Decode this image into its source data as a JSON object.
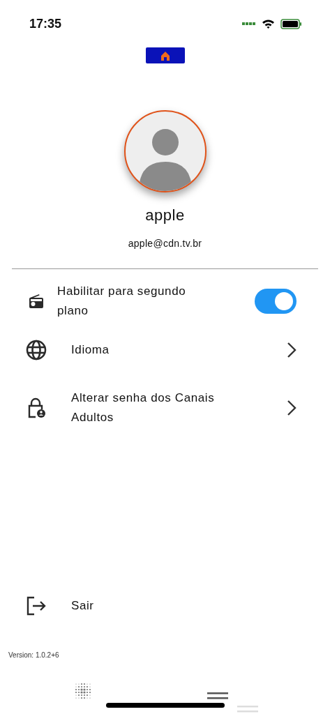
{
  "status_bar": {
    "time": "17:35"
  },
  "profile": {
    "name": "apple",
    "email": "apple@cdn.tv.br"
  },
  "settings": [
    {
      "kind": "toggle",
      "label": "Habilitar para segundo plano",
      "on": true
    },
    {
      "kind": "link",
      "label": "Idioma"
    },
    {
      "kind": "link",
      "label": "Alterar senha dos Canais Adultos"
    }
  ],
  "logout": {
    "label": "Sair"
  },
  "version": "Version: 1.0.2+6"
}
